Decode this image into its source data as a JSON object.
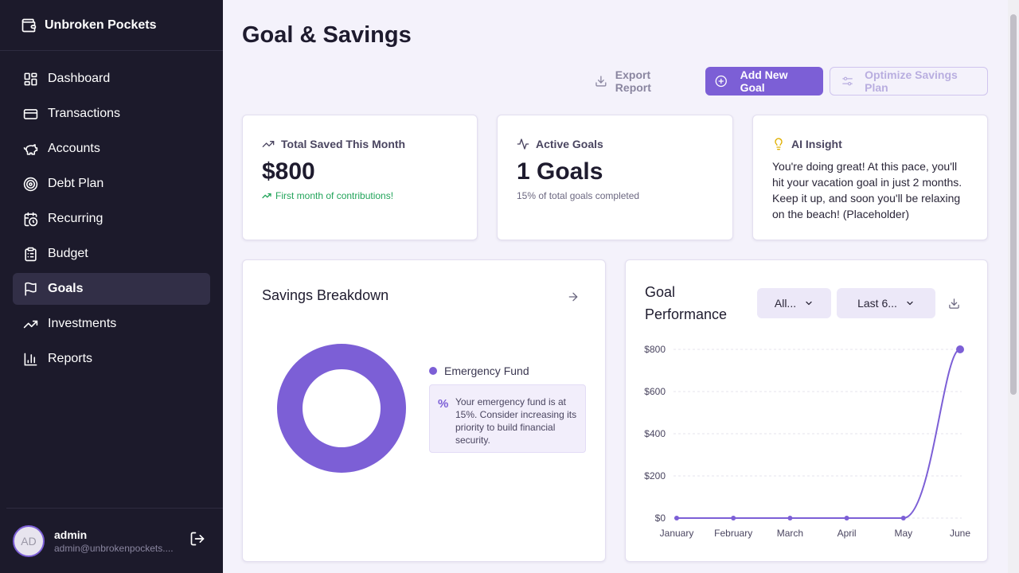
{
  "app": {
    "name": "Unbroken Pockets"
  },
  "sidebar": {
    "items": [
      {
        "label": "Dashboard",
        "icon": "dashboard-icon"
      },
      {
        "label": "Transactions",
        "icon": "credit-card-icon"
      },
      {
        "label": "Accounts",
        "icon": "piggy-bank-icon"
      },
      {
        "label": "Debt Plan",
        "icon": "target-icon"
      },
      {
        "label": "Recurring",
        "icon": "calendar-clock-icon"
      },
      {
        "label": "Budget",
        "icon": "clipboard-list-icon"
      },
      {
        "label": "Goals",
        "icon": "flag-icon",
        "active": true
      },
      {
        "label": "Investments",
        "icon": "trending-up-icon"
      },
      {
        "label": "Reports",
        "icon": "bar-chart-icon"
      }
    ]
  },
  "user": {
    "initials": "AD",
    "name": "admin",
    "email": "admin@unbrokenpockets...."
  },
  "page": {
    "title": "Goal & Savings"
  },
  "toolbar": {
    "export_label": "Export Report",
    "add_label": "Add New Goal",
    "optimize_label": "Optimize Savings Plan"
  },
  "stats": {
    "saved": {
      "label": "Total Saved This Month",
      "value": "$800",
      "sub": "First month of contributions!"
    },
    "goals": {
      "label": "Active Goals",
      "value": "1 Goals",
      "sub": "15% of total goals completed"
    },
    "insight": {
      "label": "AI Insight",
      "text": "You're doing great! At this pace, you'll hit your vacation goal in just 2 months. Keep it up, and soon you'll be relaxing on the beach! (Placeholder)"
    }
  },
  "breakdown": {
    "title": "Savings Breakdown",
    "legend": "Emergency Fund",
    "tip_icon": "%",
    "tip": "Your emergency fund is at 15%. Consider increasing its priority to build financial security."
  },
  "performance": {
    "title_line1": "Goal",
    "title_line2": "Performance",
    "filter_goal": "All...",
    "filter_range": "Last 6..."
  },
  "colors": {
    "accent": "#7c5fd6",
    "sidebar": "#1c1a2b",
    "positive": "#22a45a"
  },
  "chart_data": [
    {
      "type": "pie",
      "categories": [
        "Emergency Fund"
      ],
      "values": [
        100
      ],
      "title": "Savings Breakdown"
    },
    {
      "type": "line",
      "title": "Goal Performance",
      "categories": [
        "January",
        "February",
        "March",
        "April",
        "May",
        "June"
      ],
      "yticks": [
        "$0",
        "$200",
        "$400",
        "$600",
        "$800"
      ],
      "ylim": [
        0,
        800
      ],
      "series": [
        {
          "values": [
            0,
            0,
            0,
            0,
            0,
            800
          ]
        }
      ],
      "grid": true
    }
  ]
}
